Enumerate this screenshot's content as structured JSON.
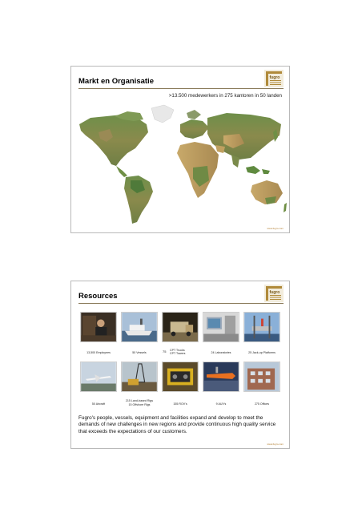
{
  "slide1": {
    "title": "Markt en Organisatie",
    "subtitle": ">13.500 medewerkers in 275 kantoren in 50 landen",
    "footer_url": "www.fugro.com"
  },
  "slide2": {
    "title": "Resources",
    "row1": [
      {
        "label": "13,500 Employees"
      },
      {
        "label": "50 Vessels"
      },
      {
        "label_num": "75",
        "label_lines": [
          "CPT Trucks",
          "CPT Towers"
        ]
      },
      {
        "label": "24 Laboratories"
      },
      {
        "label": "25 Jack-up Platforms"
      }
    ],
    "row2": [
      {
        "label": "50 Aircraft"
      },
      {
        "label_lines": [
          "215 Land-based Rigs",
          "15 Offshore Rigs"
        ]
      },
      {
        "label": "155 ROV's"
      },
      {
        "label": "9 AUV's"
      },
      {
        "label": "275 Offices"
      }
    ],
    "paragraph": "Fugro's people, vessels, equipment and facilities expand and develop to meet the demands of new challenges in new regions and provide continuous high quality service that exceeds the expectations of our customers.",
    "footer_url": "www.fugro.com"
  },
  "colors": {
    "border": "#b9b9b9",
    "accent": "#8a7a5a",
    "logo_gold": "#b08a3a"
  }
}
